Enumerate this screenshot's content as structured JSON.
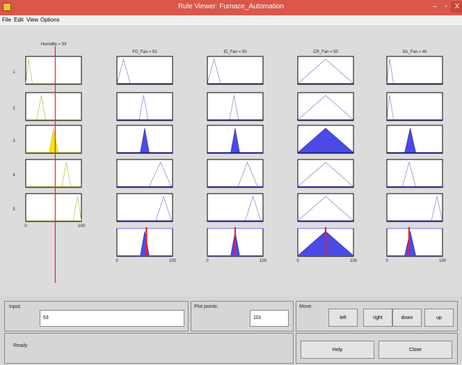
{
  "window": {
    "title": "Rule Viewer: Furnace_Automation",
    "app_icon": "matlab-icon",
    "minimize": "–",
    "maximize": "▫",
    "close": "X"
  },
  "menu": [
    "File",
    "Edit",
    "View",
    "Options"
  ],
  "inputs": [
    {
      "label": "Humidity = 53",
      "value": 53,
      "range": [
        0,
        100
      ]
    }
  ],
  "outputs": [
    {
      "label": "FD_Fan = 53",
      "value": 53,
      "range": [
        0,
        100
      ]
    },
    {
      "label": "ID_Fan = 50",
      "value": 50,
      "range": [
        0,
        100
      ]
    },
    {
      "label": "CR_Fan = 50",
      "value": 50,
      "range": [
        0,
        100
      ]
    },
    {
      "label": "SA_Fan = 40",
      "value": 40,
      "range": [
        0,
        100
      ]
    }
  ],
  "rules": [
    "1",
    "2",
    "3",
    "4",
    "5"
  ],
  "axis_ticks": [
    "0",
    "100"
  ],
  "colors": {
    "input_fill": "#f5e800",
    "output_fill": "#4a4ae6",
    "marker": "#ff1a1a",
    "input_line": "#b8b84a",
    "output_line": "#2a2ab0"
  },
  "bottom": {
    "input_label": "Input:",
    "input_value": "53",
    "plot_points_label": "Plot points:",
    "plot_points_value": "101",
    "move_label": "Move:",
    "buttons": {
      "left": "left",
      "right": "right",
      "down": "down",
      "up": "up",
      "help": "Help",
      "close": "Close"
    },
    "status": "Ready"
  }
}
